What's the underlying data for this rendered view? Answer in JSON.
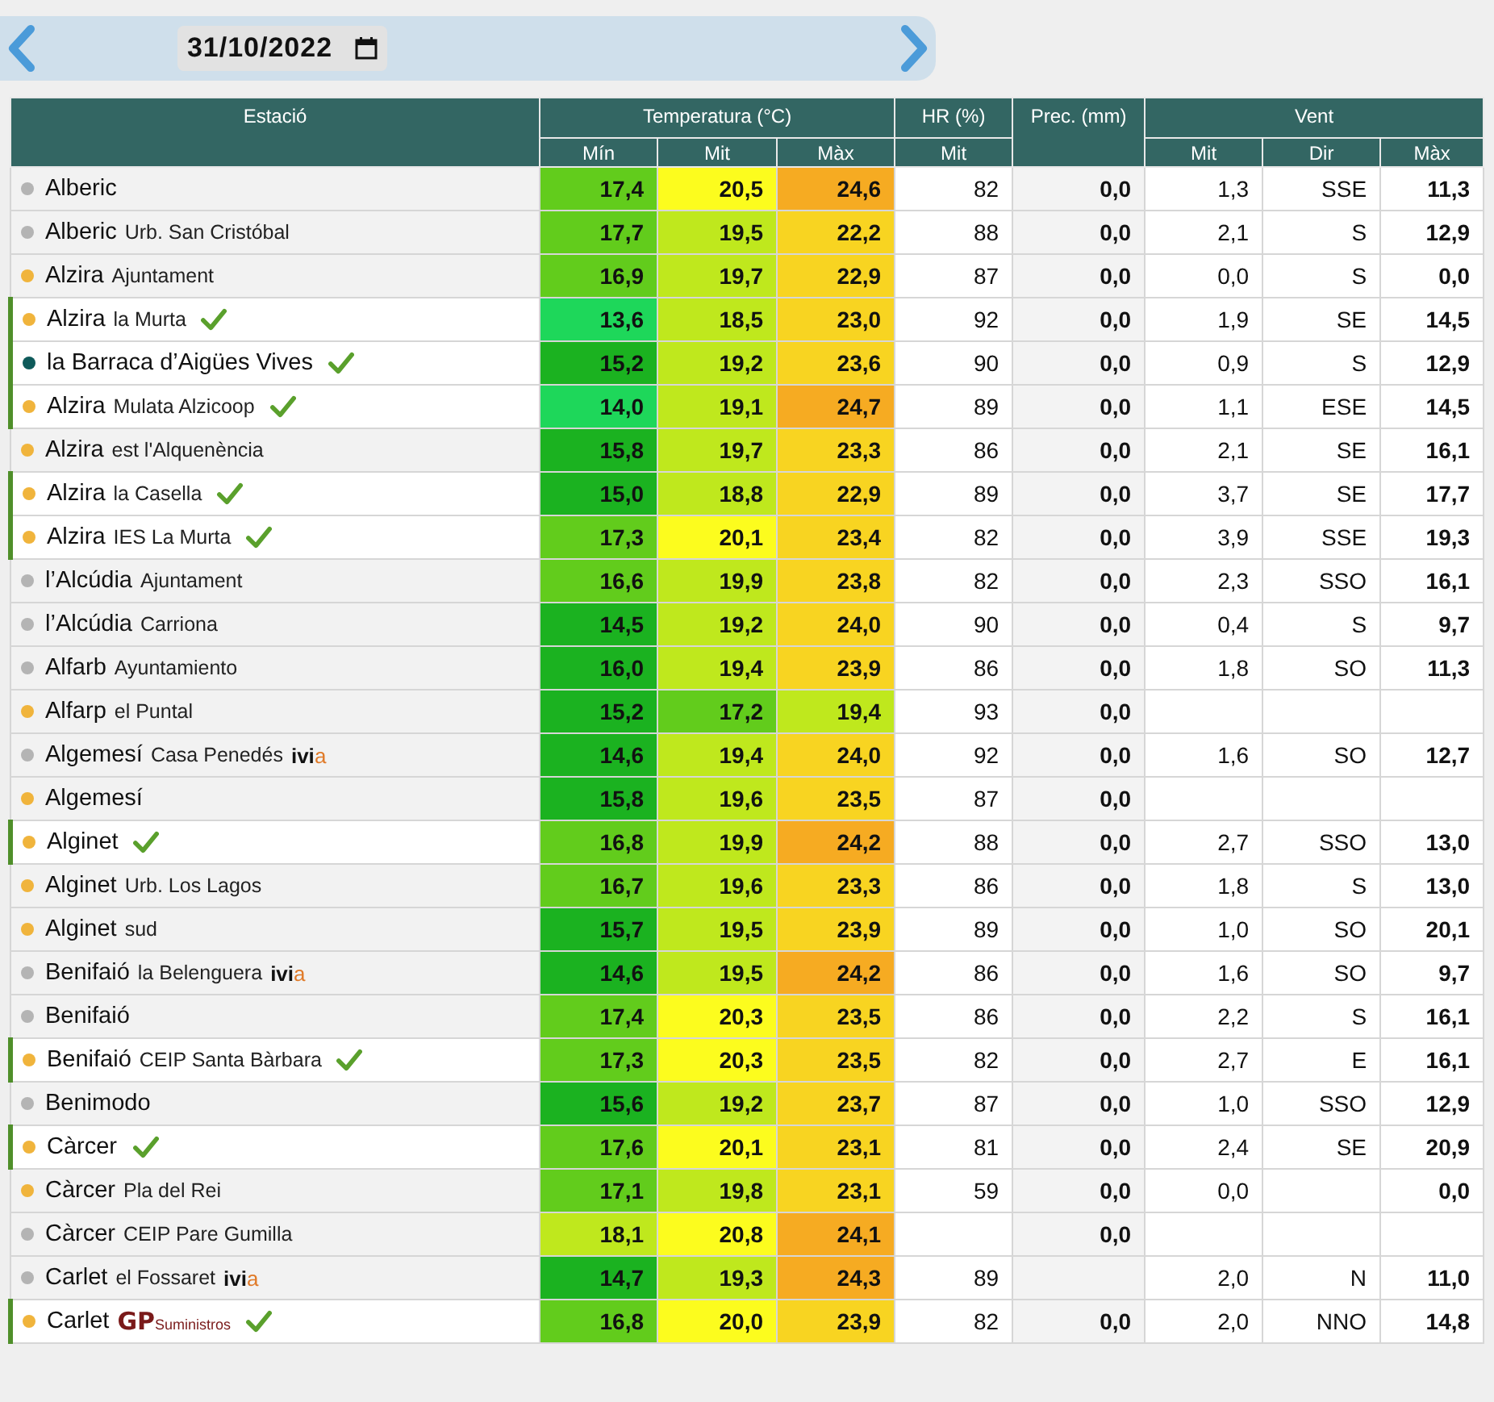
{
  "date_picker": {
    "value": "31/10/2022"
  },
  "table": {
    "groups": [
      {
        "label": "Estació"
      },
      {
        "label": "Temperatura (°C)",
        "sub": [
          "Mín",
          "Mit",
          "Màx"
        ]
      },
      {
        "label": "HR (%)",
        "sub": [
          "Mit"
        ]
      },
      {
        "label": "Prec. (mm)"
      },
      {
        "label": "Vent",
        "sub": [
          "Mit",
          "Dir",
          "Màx"
        ]
      }
    ],
    "rows": [
      {
        "station": "Alberic",
        "color": "#b4b4b4",
        "verified": false,
        "temp": [
          "17,4",
          "20,5",
          "24,6"
        ],
        "hr": "82",
        "prec": "0,0",
        "wind": {
          "mit": "1,3",
          "dir": "SSE",
          "max": "11,3"
        }
      },
      {
        "station": "Alberic",
        "detail": "Urb. San Cristóbal",
        "color": "#b4b4b4",
        "verified": false,
        "temp": [
          "17,7",
          "19,5",
          "22,2"
        ],
        "hr": "88",
        "prec": "0,0",
        "wind": {
          "mit": "2,1",
          "dir": "S",
          "max": "12,9"
        }
      },
      {
        "station": "Alzira",
        "detail": "Ajuntament",
        "color": "#f0b43c",
        "verified": false,
        "temp": [
          "16,9",
          "19,7",
          "22,9"
        ],
        "hr": "87",
        "prec": "0,0",
        "wind": {
          "mit": "0,0",
          "dir": "S",
          "max": "0,0"
        }
      },
      {
        "station": "Alzira",
        "detail": "la Murta",
        "color": "#f0b43c",
        "verified": true,
        "temp": [
          "13,6",
          "18,5",
          "23,0"
        ],
        "hr": "92",
        "prec": "0,0",
        "wind": {
          "mit": "1,9",
          "dir": "SE",
          "max": "14,5"
        }
      },
      {
        "station": "la Barraca d’Aigües Vives",
        "color": "#0e5a5a",
        "verified": true,
        "temp": [
          "15,2",
          "19,2",
          "23,6"
        ],
        "hr": "90",
        "prec": "0,0",
        "wind": {
          "mit": "0,9",
          "dir": "S",
          "max": "12,9"
        }
      },
      {
        "station": "Alzira",
        "detail": "Mulata Alzicoop",
        "color": "#f0b43c",
        "verified": true,
        "temp": [
          "14,0",
          "19,1",
          "24,7"
        ],
        "hr": "89",
        "prec": "0,0",
        "wind": {
          "mit": "1,1",
          "dir": "ESE",
          "max": "14,5"
        }
      },
      {
        "station": "Alzira",
        "detail": "est l'Alquenència",
        "color": "#f0b43c",
        "verified": false,
        "temp": [
          "15,8",
          "19,7",
          "23,3"
        ],
        "hr": "86",
        "prec": "0,0",
        "wind": {
          "mit": "2,1",
          "dir": "SE",
          "max": "16,1"
        }
      },
      {
        "station": "Alzira",
        "detail": "la Casella",
        "color": "#f0b43c",
        "verified": true,
        "temp": [
          "15,0",
          "18,8",
          "22,9"
        ],
        "hr": "89",
        "prec": "0,0",
        "wind": {
          "mit": "3,7",
          "dir": "SE",
          "max": "17,7"
        }
      },
      {
        "station": "Alzira",
        "detail": "IES La Murta",
        "color": "#f0b43c",
        "verified": true,
        "temp": [
          "17,3",
          "20,1",
          "23,4"
        ],
        "hr": "82",
        "prec": "0,0",
        "wind": {
          "mit": "3,9",
          "dir": "SSE",
          "max": "19,3"
        }
      },
      {
        "station": "l’Alcúdia",
        "detail": "Ajuntament",
        "color": "#b4b4b4",
        "verified": false,
        "temp": [
          "16,6",
          "19,9",
          "23,8"
        ],
        "hr": "82",
        "prec": "0,0",
        "wind": {
          "mit": "2,3",
          "dir": "SSO",
          "max": "16,1"
        }
      },
      {
        "station": "l’Alcúdia",
        "detail": "Carriona",
        "color": "#b4b4b4",
        "verified": false,
        "temp": [
          "14,5",
          "19,2",
          "24,0"
        ],
        "hr": "90",
        "prec": "0,0",
        "wind": {
          "mit": "0,4",
          "dir": "S",
          "max": "9,7"
        }
      },
      {
        "station": "Alfarb",
        "detail": "Ayuntamiento",
        "color": "#b4b4b4",
        "verified": false,
        "temp": [
          "16,0",
          "19,4",
          "23,9"
        ],
        "hr": "86",
        "prec": "0,0",
        "wind": {
          "mit": "1,8",
          "dir": "SO",
          "max": "11,3"
        }
      },
      {
        "station": "Alfarp",
        "detail": "el Puntal",
        "color": "#f0b43c",
        "verified": false,
        "temp": [
          "15,2",
          "17,2",
          "19,4"
        ],
        "hr": "93",
        "prec": "0,0"
      },
      {
        "station": "Algemesí",
        "detail": "Casa Penedés",
        "logo": {
          "kind": "ivia",
          "text": "ivi",
          "accent": "a"
        },
        "color": "#b4b4b4",
        "verified": false,
        "temp": [
          "14,6",
          "19,4",
          "24,0"
        ],
        "hr": "92",
        "prec": "0,0",
        "wind": {
          "mit": "1,6",
          "dir": "SO",
          "max": "12,7"
        }
      },
      {
        "station": "Algemesí",
        "color": "#f0b43c",
        "verified": false,
        "temp": [
          "15,8",
          "19,6",
          "23,5"
        ],
        "hr": "87",
        "prec": "0,0"
      },
      {
        "station": "Alginet",
        "color": "#f0b43c",
        "verified": true,
        "temp": [
          "16,8",
          "19,9",
          "24,2"
        ],
        "hr": "88",
        "prec": "0,0",
        "wind": {
          "mit": "2,7",
          "dir": "SSO",
          "max": "13,0"
        }
      },
      {
        "station": "Alginet",
        "detail": "Urb. Los Lagos",
        "color": "#f0b43c",
        "verified": false,
        "temp": [
          "16,7",
          "19,6",
          "23,3"
        ],
        "hr": "86",
        "prec": "0,0",
        "wind": {
          "mit": "1,8",
          "dir": "S",
          "max": "13,0"
        }
      },
      {
        "station": "Alginet",
        "detail": "sud",
        "color": "#f0b43c",
        "verified": false,
        "temp": [
          "15,7",
          "19,5",
          "23,9"
        ],
        "hr": "89",
        "prec": "0,0",
        "wind": {
          "mit": "1,0",
          "dir": "SO",
          "max": "20,1"
        }
      },
      {
        "station": "Benifaió",
        "detail": "la Belenguera",
        "logo": {
          "kind": "ivia",
          "text": "ivi",
          "accent": "a"
        },
        "color": "#b4b4b4",
        "verified": false,
        "temp": [
          "14,6",
          "19,5",
          "24,2"
        ],
        "hr": "86",
        "prec": "0,0",
        "wind": {
          "mit": "1,6",
          "dir": "SO",
          "max": "9,7"
        }
      },
      {
        "station": "Benifaió",
        "color": "#b4b4b4",
        "verified": false,
        "temp": [
          "17,4",
          "20,3",
          "23,5"
        ],
        "hr": "86",
        "prec": "0,0",
        "wind": {
          "mit": "2,2",
          "dir": "S",
          "max": "16,1"
        }
      },
      {
        "station": "Benifaió",
        "detail": "CEIP Santa Bàrbara",
        "color": "#f0b43c",
        "verified": true,
        "temp": [
          "17,3",
          "20,3",
          "23,5"
        ],
        "hr": "82",
        "prec": "0,0",
        "wind": {
          "mit": "2,7",
          "dir": "E",
          "max": "16,1"
        }
      },
      {
        "station": "Benimodo",
        "color": "#b4b4b4",
        "verified": false,
        "temp": [
          "15,6",
          "19,2",
          "23,7"
        ],
        "hr": "87",
        "prec": "0,0",
        "wind": {
          "mit": "1,0",
          "dir": "SSO",
          "max": "12,9"
        }
      },
      {
        "station": "Càrcer",
        "color": "#f0b43c",
        "verified": true,
        "temp": [
          "17,6",
          "20,1",
          "23,1"
        ],
        "hr": "81",
        "prec": "0,0",
        "wind": {
          "mit": "2,4",
          "dir": "SE",
          "max": "20,9"
        }
      },
      {
        "station": "Càrcer",
        "detail": "Pla del Rei",
        "color": "#f0b43c",
        "verified": false,
        "temp": [
          "17,1",
          "19,8",
          "23,1"
        ],
        "hr": "59",
        "prec": "0,0",
        "wind": {
          "mit": "0,0",
          "max": "0,0"
        }
      },
      {
        "station": "Càrcer",
        "detail": "CEIP Pare Gumilla",
        "color": "#b4b4b4",
        "verified": false,
        "temp": [
          "18,1",
          "20,8",
          "24,1"
        ],
        "prec": "0,0"
      },
      {
        "station": "Carlet",
        "detail": "el Fossaret",
        "logo": {
          "kind": "ivia",
          "text": "ivi",
          "accent": "a"
        },
        "color": "#b4b4b4",
        "verified": false,
        "temp": [
          "14,7",
          "19,3",
          "24,3"
        ],
        "hr": "89",
        "wind": {
          "mit": "2,0",
          "dir": "N",
          "max": "11,0"
        }
      },
      {
        "station": "Carlet",
        "logo": {
          "kind": "gp",
          "text": "GP",
          "accent": "Suministros"
        },
        "color": "#f0b43c",
        "verified": true,
        "temp": [
          "16,8",
          "20,0",
          "23,9"
        ],
        "hr": "82",
        "prec": "0,0",
        "wind": {
          "mit": "2,0",
          "dir": "NNO",
          "max": "14,8"
        }
      }
    ]
  }
}
